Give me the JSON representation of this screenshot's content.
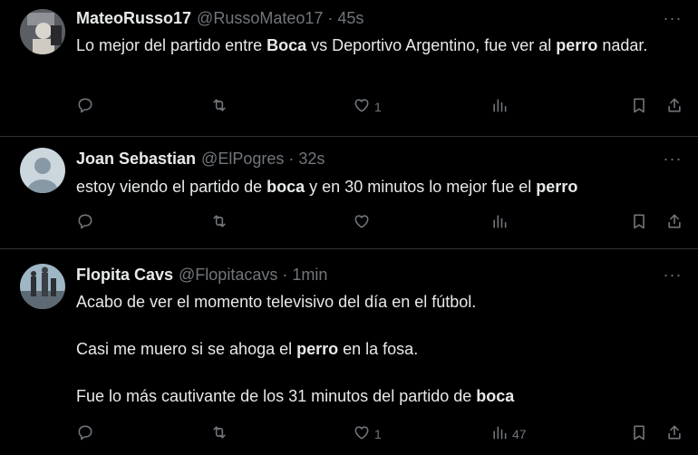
{
  "tweets": [
    {
      "name": "MateoRusso17",
      "handle": "@RussoMateo17",
      "separator": "·",
      "time": "45s",
      "text_parts": [
        {
          "t": "Lo mejor del partido entre ",
          "b": false
        },
        {
          "t": "Boca",
          "b": true
        },
        {
          "t": " vs Deportivo Argentino, fue ver al ",
          "b": false
        },
        {
          "t": "perro",
          "b": true
        },
        {
          "t": " nadar.",
          "b": false
        }
      ],
      "likes": "1",
      "views": ""
    },
    {
      "name": "Joan Sebastian",
      "handle": "@ElPogres",
      "separator": "·",
      "time": "32s",
      "text_parts": [
        {
          "t": "estoy viendo el partido de ",
          "b": false
        },
        {
          "t": "boca",
          "b": true
        },
        {
          "t": " y en 30 minutos lo mejor fue el ",
          "b": false
        },
        {
          "t": "perro",
          "b": true
        }
      ],
      "likes": "",
      "views": ""
    },
    {
      "name": "Flopita Cavs",
      "handle": "@Flopitacavs",
      "separator": "·",
      "time": "1min",
      "paragraphs": [
        [
          {
            "t": "Acabo de ver el momento televisivo del día en el fútbol.",
            "b": false
          }
        ],
        [
          {
            "t": "Casi me muero si se ahoga el ",
            "b": false
          },
          {
            "t": "perro",
            "b": true
          },
          {
            "t": " en la fosa.",
            "b": false
          }
        ],
        [
          {
            "t": "Fue lo más cautivante de los 31 minutos del partido de ",
            "b": false
          },
          {
            "t": "boca",
            "b": true
          }
        ]
      ],
      "likes": "1",
      "views": "47"
    }
  ],
  "more_glyph": "···",
  "icons": [
    "reply-icon",
    "retweet-icon",
    "like-icon",
    "views-icon",
    "bookmark-icon",
    "share-icon"
  ],
  "colors": {
    "background": "#000000",
    "text": "#e7e9ea",
    "muted": "#71767b",
    "divider": "#2f3336"
  }
}
